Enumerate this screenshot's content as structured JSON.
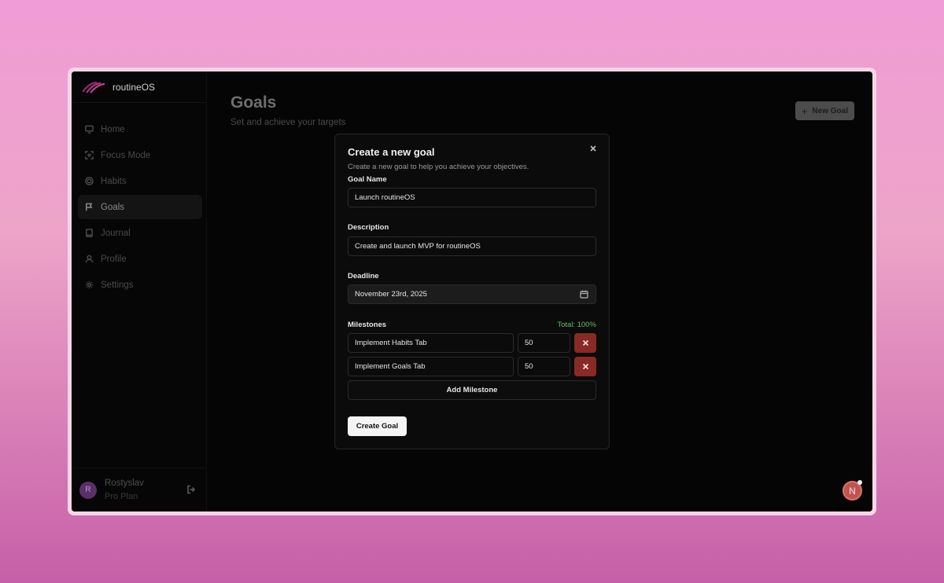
{
  "app": {
    "name": "routineOS"
  },
  "sidebar": {
    "items": [
      {
        "label": "Home",
        "icon": "monitor-icon",
        "active": false
      },
      {
        "label": "Focus Mode",
        "icon": "focus-icon",
        "active": false
      },
      {
        "label": "Habits",
        "icon": "target-icon",
        "active": false
      },
      {
        "label": "Goals",
        "icon": "flag-icon",
        "active": true
      },
      {
        "label": "Journal",
        "icon": "book-icon",
        "active": false
      },
      {
        "label": "Profile",
        "icon": "user-icon",
        "active": false
      },
      {
        "label": "Settings",
        "icon": "gear-icon",
        "active": false
      }
    ],
    "user": {
      "initial": "R",
      "name": "Rostyslav",
      "plan": "Pro Plan"
    }
  },
  "header": {
    "title": "Goals",
    "subtitle": "Set and achieve your targets",
    "new_goal_label": "New Goal"
  },
  "modal": {
    "title": "Create a new goal",
    "description": "Create a new goal to help you achieve your objectives.",
    "goal_name_label": "Goal Name",
    "goal_name_value": "Launch routineOS",
    "description_label": "Description",
    "description_value": "Create and launch MVP for routineOS",
    "deadline_label": "Deadline",
    "deadline_value": "November 23rd, 2025",
    "milestones_label": "Milestones",
    "total_label": "Total: 100%",
    "milestones": [
      {
        "name": "Implement Habits Tab",
        "percent": "50"
      },
      {
        "name": "Implement Goals Tab",
        "percent": "50"
      }
    ],
    "add_milestone_label": "Add Milestone",
    "create_label": "Create Goal"
  },
  "notification": {
    "initial": "N"
  },
  "colors": {
    "accent_success": "#5fbf63",
    "delete_button": "#8a2a24",
    "notification_avatar": "#c2524d",
    "user_avatar": "#5a2f6a"
  }
}
